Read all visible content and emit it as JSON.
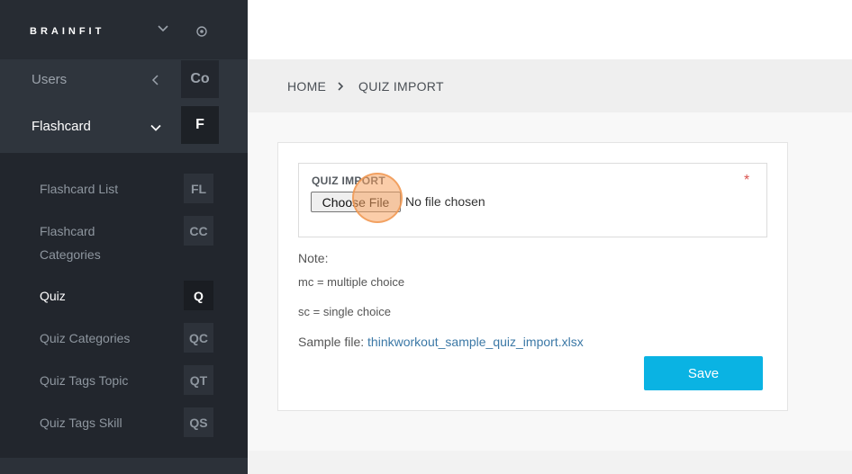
{
  "app": {
    "brand": "BRAINFIT"
  },
  "sidebar": {
    "menus": [
      {
        "label": "Users",
        "abbr": "Co"
      },
      {
        "label": "Flashcard",
        "abbr": "F"
      }
    ],
    "submenu": [
      {
        "label": "Flashcard List",
        "abbr": "FL"
      },
      {
        "label": "Flashcard Categories",
        "abbr": "CC"
      },
      {
        "label": "Quiz",
        "abbr": "Q",
        "active": true
      },
      {
        "label": "Quiz Categories",
        "abbr": "QC"
      },
      {
        "label": "Quiz Tags Topic",
        "abbr": "QT"
      },
      {
        "label": "Quiz Tags Skill",
        "abbr": "QS"
      }
    ]
  },
  "breadcrumb": {
    "home": "HOME",
    "current": "QUIZ IMPORT"
  },
  "form": {
    "field_label": "QUIZ IMPORT",
    "required_mark": "*",
    "choose_file_label": "Choose File",
    "no_file_text": "No file chosen",
    "note_title": "Note:",
    "note_mc": "mc = multiple choice",
    "note_sc": "sc = single choice",
    "sample_prefix": "Sample file:",
    "sample_link": "thinkworkout_sample_quiz_import.xlsx",
    "save_label": "Save"
  },
  "colors": {
    "accent": "#0ab3e3",
    "link": "#3b78a6",
    "sidebar": "#2c3139",
    "required": "#d9534f"
  },
  "icons": {
    "brand_toggle": "chevron-down-icon",
    "brand_settings": "target-icon",
    "users_toggle": "chevron-left-icon",
    "flashcard_toggle": "chevron-down-icon",
    "breadcrumb_separator": "chevron-right-icon"
  }
}
